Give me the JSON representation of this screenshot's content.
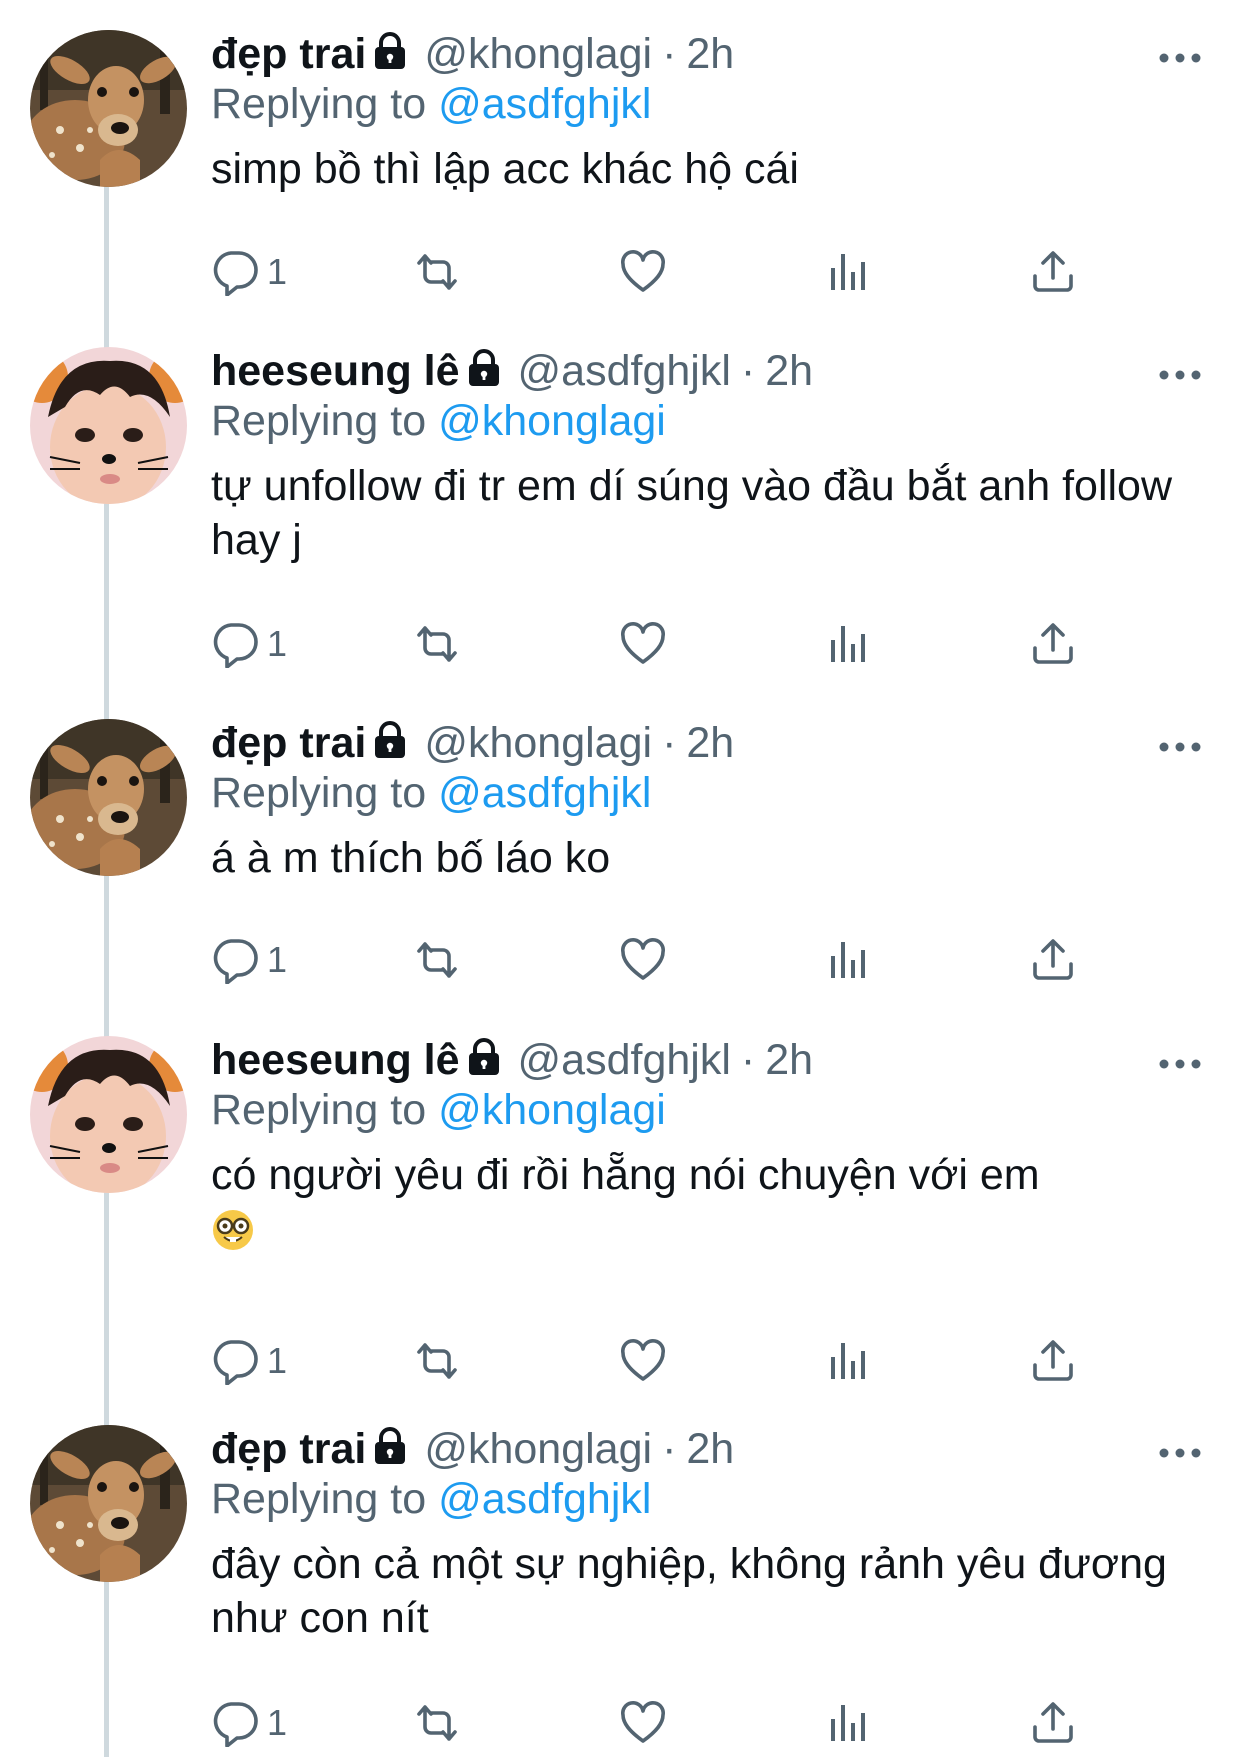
{
  "colors": {
    "text": "#0f1419",
    "secondary": "#536471",
    "link": "#1d9bf0",
    "thread_line": "#cfd9de"
  },
  "tweets": [
    {
      "avatar": "deer-avatar",
      "display_name": "đẹp trai",
      "handle": "@khonglagi",
      "separator": "·",
      "time": "2h",
      "replying_prefix": "Replying to",
      "replying_to": "@asdfghjkl",
      "text": "simp bồ thì lập acc khác hộ cái",
      "reply_count": "1"
    },
    {
      "avatar": "boy-cat-filter-avatar",
      "display_name": "heeseung lê",
      "handle": "@asdfghjkl",
      "separator": "·",
      "time": "2h",
      "replying_prefix": "Replying to",
      "replying_to": "@khonglagi",
      "text": "tự unfollow đi tr em dí súng vào đầu bắt anh follow hay j",
      "reply_count": "1"
    },
    {
      "avatar": "deer-avatar",
      "display_name": "đẹp trai",
      "handle": "@khonglagi",
      "separator": "·",
      "time": "2h",
      "replying_prefix": "Replying to",
      "replying_to": "@asdfghjkl",
      "text": "á à m thích bố láo ko",
      "reply_count": "1"
    },
    {
      "avatar": "boy-cat-filter-avatar",
      "display_name": "heeseung lê",
      "handle": "@asdfghjkl",
      "separator": "·",
      "time": "2h",
      "replying_prefix": "Replying to",
      "replying_to": "@khonglagi",
      "text": "có người yêu đi rồi hẵng nói chuyện với em",
      "emoji": "nerd-face-emoji",
      "reply_count": "1"
    },
    {
      "avatar": "deer-avatar",
      "display_name": "đẹp trai",
      "handle": "@khonglagi",
      "separator": "·",
      "time": "2h",
      "replying_prefix": "Replying to",
      "replying_to": "@asdfghjkl",
      "text": "đây còn cả một sự nghiệp, không rảnh yêu đương như con nít",
      "reply_count": "1"
    }
  ]
}
